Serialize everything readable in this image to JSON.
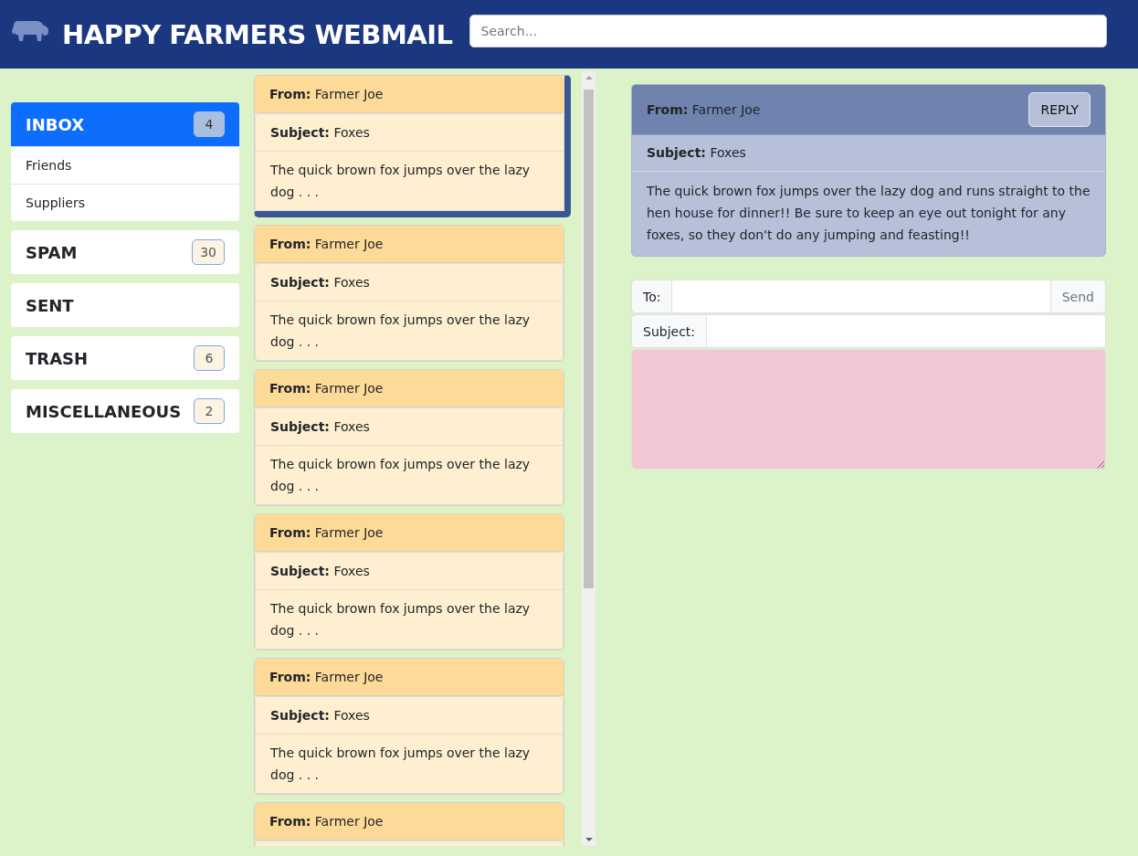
{
  "header": {
    "title": "HAPPY FARMERS WEBMAIL",
    "search": {
      "placeholder": "Search..."
    }
  },
  "folders": [
    {
      "name": "INBOX",
      "count": "4",
      "selected": true,
      "children": [
        {
          "name": "Friends"
        },
        {
          "name": "Suppliers"
        }
      ]
    },
    {
      "name": "SPAM",
      "count": "30",
      "selected": false
    },
    {
      "name": "SENT",
      "selected": false
    },
    {
      "name": "TRASH",
      "count": "6",
      "selected": false
    },
    {
      "name": "MISCELLANEOUS",
      "count": "2",
      "selected": false
    }
  ],
  "messages": [
    {
      "from": "**From:** Farmer Joe",
      "subject": "**Subject:** Foxes",
      "preview": "The quick brown fox jumps over the lazy dog . . .",
      "selected": true
    },
    {
      "from": "**From:** Farmer Joe",
      "subject": "**Subject:** Foxes",
      "preview": "The quick brown fox jumps over the lazy dog . . .",
      "selected": false
    },
    {
      "from": "**From:** Farmer Joe",
      "subject": "**Subject:** Foxes",
      "preview": "The quick brown fox jumps over the lazy dog . . .",
      "selected": false
    },
    {
      "from": "**From:** Farmer Joe",
      "subject": "**Subject:** Foxes",
      "preview": "The quick brown fox jumps over the lazy dog . . .",
      "selected": false
    },
    {
      "from": "**From:** Farmer Joe",
      "subject": "**Subject:** Foxes",
      "preview": "The quick brown fox jumps over the lazy dog . . .",
      "selected": false
    },
    {
      "from": "**From:** Farmer Joe",
      "selected": false
    }
  ],
  "reader": {
    "from": "**From:** Farmer Joe",
    "reply_button": "REPLY",
    "subject": "**Subject:** Foxes",
    "body": "The quick brown fox jumps over the lazy dog and runs straight to the hen house for dinner!! Be sure to keep an eye out tonight for any foxes, so they don't do any jumping and feasting!!"
  },
  "compose": {
    "to_label": "To:",
    "send_button": "Send",
    "subject_label": "Subject:"
  }
}
